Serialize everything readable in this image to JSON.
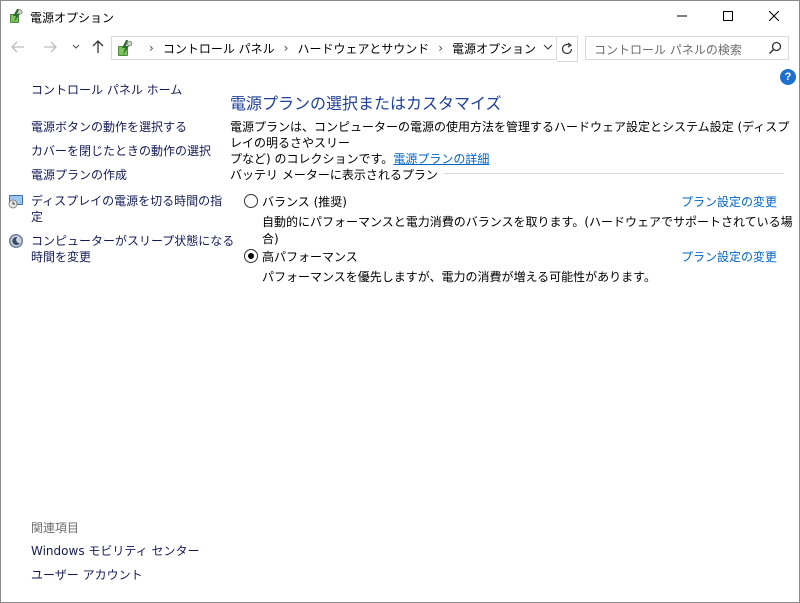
{
  "window": {
    "title": "電源オプション"
  },
  "address": {
    "crumbs": [
      "コントロール パネル",
      "ハードウェアとサウンド",
      "電源オプション"
    ]
  },
  "search": {
    "placeholder": "コントロール パネルの検索"
  },
  "help": {
    "label": "?"
  },
  "sidebar": {
    "home": "コントロール パネル ホーム",
    "links": [
      "電源ボタンの動作を選択する",
      "カバーを閉じたときの動作の選択",
      "電源プランの作成"
    ],
    "display_off_line1": "ディスプレイの電源を切る時間の指",
    "display_off_line2": "定",
    "sleep_line1": "コンピューターがスリープ状態になる",
    "sleep_line2": "時間を変更",
    "related_title": "関連項目",
    "related": [
      "Windows モビリティ センター",
      "ユーザー アカウント"
    ]
  },
  "main": {
    "title": "電源プランの選択またはカスタマイズ",
    "desc_line1": "電源プランは、コンピューターの電源の使用方法を管理するハードウェア設定とシステム設定 (ディスプレイの明るさやスリー",
    "desc_line2": "プなど) のコレクションです。",
    "desc_link": "電源プランの詳細",
    "section": "バッテリ メーターに表示されるプラン",
    "plans": [
      {
        "name": "バランス (推奨)",
        "desc": "自動的にパフォーマンスと電力消費のバランスを取ります。(ハードウェアでサポートされている場合)",
        "link": "プラン設定の変更",
        "selected": false
      },
      {
        "name": "高パフォーマンス",
        "desc": "パフォーマンスを優先しますが、電力の消費が増える可能性があります。",
        "link": "プラン設定の変更",
        "selected": true
      }
    ]
  },
  "colors": {
    "accent": "#1f3f9a",
    "link": "#0066cc",
    "nav_link": "#151c55"
  },
  "icons": [
    "power-options-icon",
    "minimize-icon",
    "maximize-icon",
    "close-icon",
    "back-arrow-icon",
    "forward-arrow-icon",
    "history-chevron-icon",
    "up-arrow-icon",
    "refresh-icon",
    "search-icon",
    "help-icon",
    "display-icon",
    "sleep-icon"
  ]
}
